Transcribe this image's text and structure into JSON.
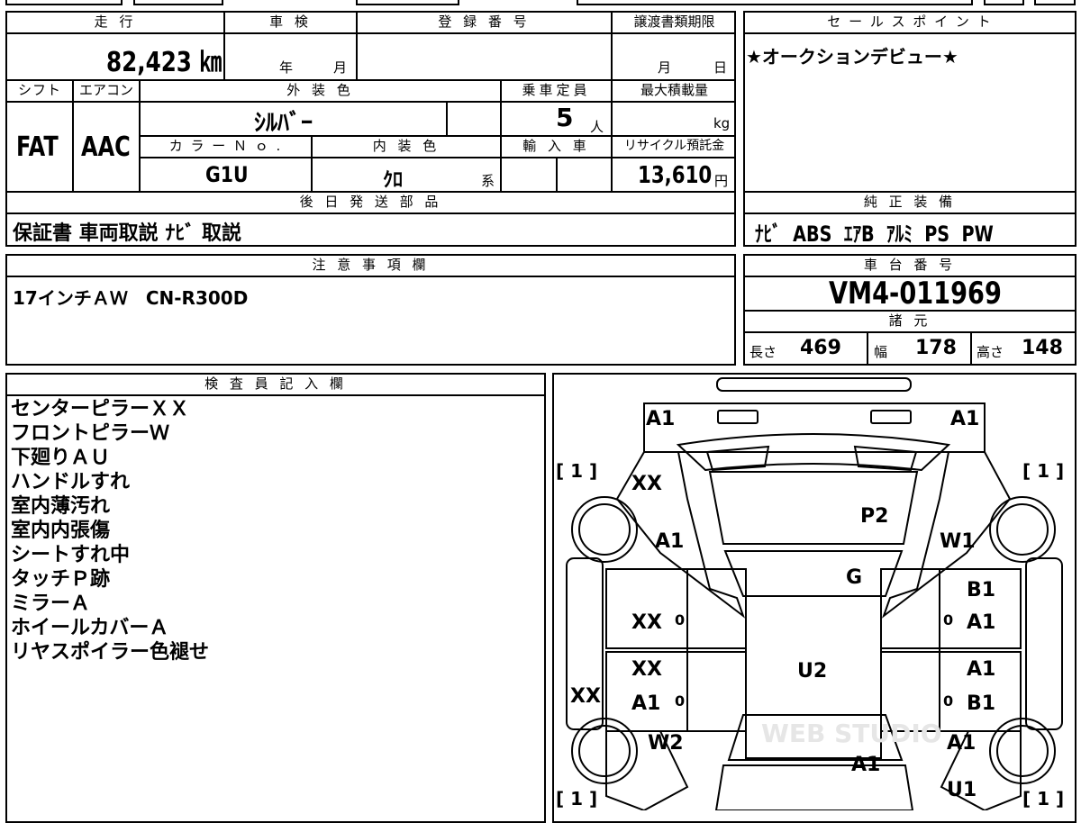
{
  "mileage": {
    "header": "走 行",
    "value": "82,423 ㎞"
  },
  "inspection": {
    "header": "車 検",
    "year_unit": "年",
    "month_unit": "月"
  },
  "registration": {
    "header": "登 録 番 号"
  },
  "transfer_deadline": {
    "header": "譲渡書類期限",
    "month_unit": "月",
    "day_unit": "日"
  },
  "shift": {
    "header": "シフト",
    "value": "FAT"
  },
  "aircon": {
    "header": "エアコン",
    "value": "AAC"
  },
  "exterior_color": {
    "header": "外 装 色",
    "value": "ｼﾙﾊﾞｰ"
  },
  "capacity": {
    "header": "乗車定員",
    "value": "5",
    "unit": "人"
  },
  "max_load": {
    "header": "最大積載量",
    "unit": "kg"
  },
  "color_no": {
    "header": "カ ラ ー Ｎ ｏ .",
    "value": "G1U"
  },
  "interior_color": {
    "header": "内 装 色",
    "value": "ｸﾛ",
    "suffix": "系"
  },
  "import": {
    "header": "輸 入 車"
  },
  "recycle": {
    "header": "リサイクル預託金",
    "value": "13,610",
    "unit": "円"
  },
  "sales_point": {
    "header": "セ ー ル ス ポ イ ン ト",
    "value": "★オークションデビュー★"
  },
  "later_parts": {
    "header": "後 日 発 送 部 品",
    "value": "保証書 車両取説 ﾅﾋﾞ 取説"
  },
  "standard_equipment": {
    "header": "純 正 装 備",
    "value": "ﾅﾋﾞ  ABS  ｴｱB  ｱﾙﾐ  PS  PW"
  },
  "notes": {
    "header": "注 意 事 項 欄",
    "value": "17インチＡＷ　CN-R300D"
  },
  "chassis": {
    "header": "車 台 番 号",
    "value": "VM4-011969"
  },
  "specs": {
    "header": "諸 元",
    "length_label": "長さ",
    "length": "469",
    "width_label": "幅",
    "width": "178",
    "height_label": "高さ",
    "height": "148"
  },
  "inspector": {
    "header": "検 査 員 記 入 欄",
    "lines": [
      "センターピラーＸＸ",
      "フロントピラーＷ",
      "下廻りＡＵ",
      "ハンドルすれ",
      "室内薄汚れ",
      "室内内張傷",
      "シートすれ中",
      "タッチＰ跡",
      "ミラーＡ",
      "ホイールカバーＡ",
      "リヤスポイラー色褪せ"
    ]
  },
  "diagram": {
    "marks": {
      "front_left": "A1",
      "front_right": "A1",
      "hood": "P2",
      "windshield": "G",
      "roof": "U2",
      "fl_pillar": "XX",
      "fl_fender": "A1",
      "fr_fender": "W1",
      "fl_door": "XX",
      "fr_door_1": "B1",
      "fr_door_2": "A1",
      "rl_door_1": "XX",
      "rl_door_2": "A1",
      "rl_side": "XX",
      "rr_door_1": "A1",
      "rr_door_2": "B1",
      "rl_fender": "W2",
      "rr_fender": "A1",
      "rear": "A1",
      "rear_right": "U1"
    },
    "tire_label": "[ 1 ]",
    "door_marks": "0",
    "watermark": "WEB STUDIO"
  }
}
